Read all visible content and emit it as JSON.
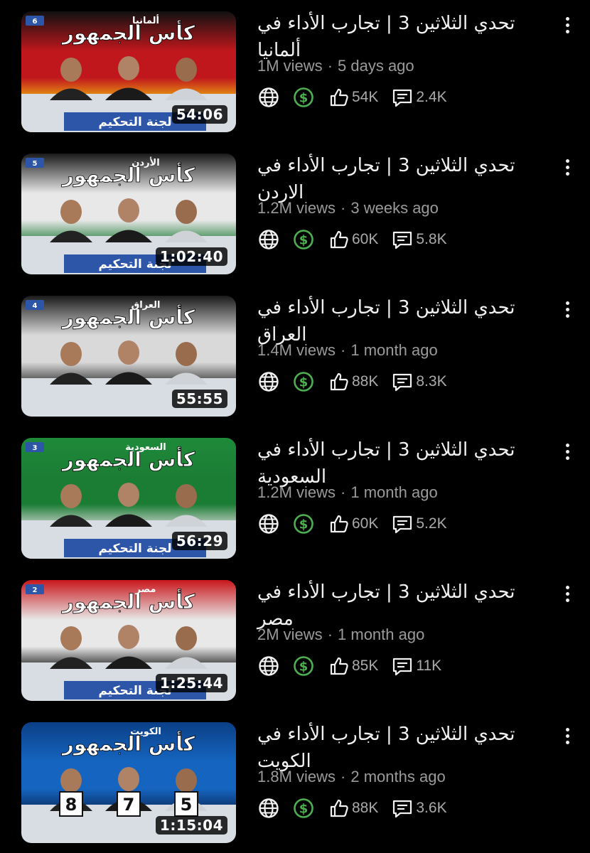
{
  "colors": {
    "background": "#000000",
    "meta_text": "#9a9a9a",
    "stat_text": "#aaaaaa",
    "monetized_green": "#4caf50"
  },
  "icons": {
    "globe": "globe-icon",
    "monetization": "dollar-circle-icon",
    "likes": "thumbs-up-icon",
    "comments": "comment-icon",
    "more": "more-vert-icon"
  },
  "videos": [
    {
      "title_line1": "تحدي الثلاثين 3 | تجارب الأداء في",
      "title_line2": "ألمانيا",
      "views": "1M views",
      "age": "5 days ago",
      "likes": "54K",
      "comments": "2.4K",
      "duration": "54:06",
      "thumb": {
        "bg1": "#111111",
        "bg2": "#c0171c",
        "bg3": "#f1b80e",
        "episode": "6",
        "country": "ألمانيا",
        "show": "كأس الجمهور",
        "banner": "لجنة التحكيم"
      }
    },
    {
      "title_line1": "تحدي الثلاثين 3 | تجارب الأداء في",
      "title_line2": "الاردن",
      "views": "1.2M views",
      "age": "3 weeks ago",
      "likes": "60K",
      "comments": "5.8K",
      "duration": "1:02:40",
      "thumb": {
        "bg1": "#1a1a1a",
        "bg2": "#e8e8e8",
        "bg3": "#1e7a36",
        "episode": "5",
        "country": "الأردن",
        "show": "كأس الجمهور",
        "banner": "لجنة التحكيم"
      }
    },
    {
      "title_line1": "تحدي الثلاثين 3 | تجارب الأداء في",
      "title_line2": "العراق",
      "views": "1.4M views",
      "age": "1 month ago",
      "likes": "88K",
      "comments": "8.3K",
      "duration": "55:55",
      "thumb": {
        "bg1": "#1a1a1a",
        "bg2": "#d9d9d9",
        "bg3": "#2b2b2b",
        "episode": "4",
        "country": "العراق",
        "show": "كأس الجمهور",
        "banner": ""
      }
    },
    {
      "title_line1": "تحدي الثلاثين 3 | تجارب الأداء في",
      "title_line2": "السعودية",
      "views": "1.2M views",
      "age": "1 month ago",
      "likes": "60K",
      "comments": "5.2K",
      "duration": "56:29",
      "thumb": {
        "bg1": "#1f8a3a",
        "bg2": "#1b7d34",
        "bg3": "#d9d9d9",
        "episode": "3",
        "country": "السعودية",
        "show": "كأس الجمهور",
        "banner": "لجنة التحكيم"
      }
    },
    {
      "title_line1": "تحدي الثلاثين 3 | تجارب الأداء في",
      "title_line2": "مصر",
      "views": "2M views",
      "age": "1 month ago",
      "likes": "85K",
      "comments": "11K",
      "duration": "1:25:44",
      "thumb": {
        "bg1": "#c8171c",
        "bg2": "#e8e8e8",
        "bg3": "#111111",
        "episode": "2",
        "country": "مصر",
        "show": "كأس الجمهور",
        "banner": "لجنة التحكيم"
      }
    },
    {
      "title_line1": "تحدي الثلاثين 3 | تجارب الأداء في",
      "title_line2": "الكويت",
      "views": "1.8M views",
      "age": "2 months ago",
      "likes": "88K",
      "comments": "3.6K",
      "duration": "1:15:04",
      "thumb": {
        "bg1": "#0b3f86",
        "bg2": "#1565c0",
        "bg3": "#0a2a5a",
        "episode": "",
        "country": "الكويت",
        "show": "كأس الجمهور",
        "banner": "",
        "score_cards": [
          "8",
          "7",
          "5"
        ]
      }
    }
  ]
}
